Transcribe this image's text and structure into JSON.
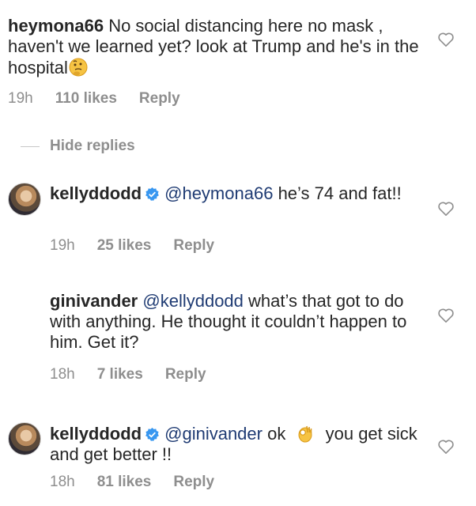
{
  "comments": [
    {
      "username": "heymona66",
      "text": "No social distancing here no mask , haven't we learned yet? look at Trump and he's in the hospital",
      "emoji": "thinking-face",
      "time": "19h",
      "likes": "110 likes",
      "reply": "Reply"
    },
    {
      "username": "kellyddodd",
      "verified": true,
      "mention": "@heymona66",
      "text": "he’s 74 and fat!!",
      "time": "19h",
      "likes": "25 likes",
      "reply": "Reply"
    },
    {
      "username": "ginivander",
      "mention": "@kellyddodd",
      "text": "what’s that got to do with anything. He thought it couldn’t happen to him. Get it?",
      "time": "18h",
      "likes": "7 likes",
      "reply": "Reply"
    },
    {
      "username": "kellyddodd",
      "verified": true,
      "mention": "@ginivander",
      "text_before": "ok",
      "emoji": "ok-hand",
      "text": "you get sick and get better !!",
      "time": "18h",
      "likes": "81 likes",
      "reply": "Reply"
    }
  ],
  "hide_replies": "Hide replies",
  "colors": {
    "text": "#262626",
    "meta": "#8e8e8e",
    "verified": "#3897f0"
  }
}
